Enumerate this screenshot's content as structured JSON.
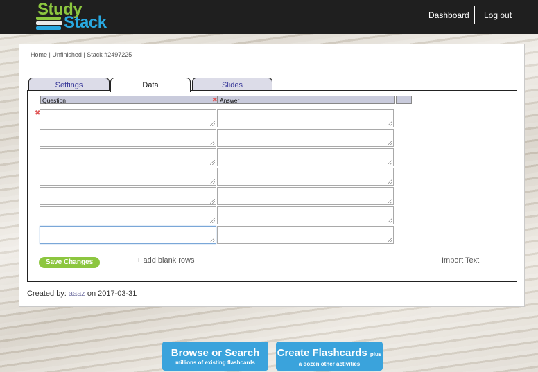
{
  "header": {
    "logo_top": "Study",
    "logo_bottom": "Stack",
    "nav": {
      "dashboard": "Dashboard",
      "logout": "Log out"
    }
  },
  "breadcrumb": {
    "home": "Home",
    "sep1": " | ",
    "unfinished": "Unfinished",
    "sep2": " | ",
    "stack": "Stack #2497225"
  },
  "tabs": [
    {
      "label": "Settings",
      "active": false
    },
    {
      "label": "Data",
      "active": true
    },
    {
      "label": "Slides",
      "active": false
    }
  ],
  "table": {
    "columns": [
      "Question",
      "Answer"
    ],
    "delete_glyph": "✖",
    "rows": [
      {
        "question": "",
        "answer": ""
      },
      {
        "question": "",
        "answer": ""
      },
      {
        "question": "",
        "answer": ""
      },
      {
        "question": "",
        "answer": ""
      },
      {
        "question": "",
        "answer": ""
      },
      {
        "question": "",
        "answer": ""
      },
      {
        "question": "",
        "answer": ""
      }
    ]
  },
  "actions": {
    "save": "Save Changes",
    "add_rows": "+ add blank rows",
    "import": "Import Text"
  },
  "footer_info": {
    "prefix": "Created by: ",
    "user": "aaaz",
    "middle": " on ",
    "date": "2017-03-31"
  },
  "cta": {
    "browse_main": "Browse or Search",
    "browse_sub": "millions of existing flashcards",
    "create_main": "Create Flashcards",
    "create_plus": "plus",
    "create_sub": "a dozen other activities"
  },
  "colors": {
    "brand_green": "#8cc63f",
    "brand_blue": "#29a8e0",
    "cta_blue": "#3aa3dc",
    "topbar": "#1f1f1f"
  }
}
